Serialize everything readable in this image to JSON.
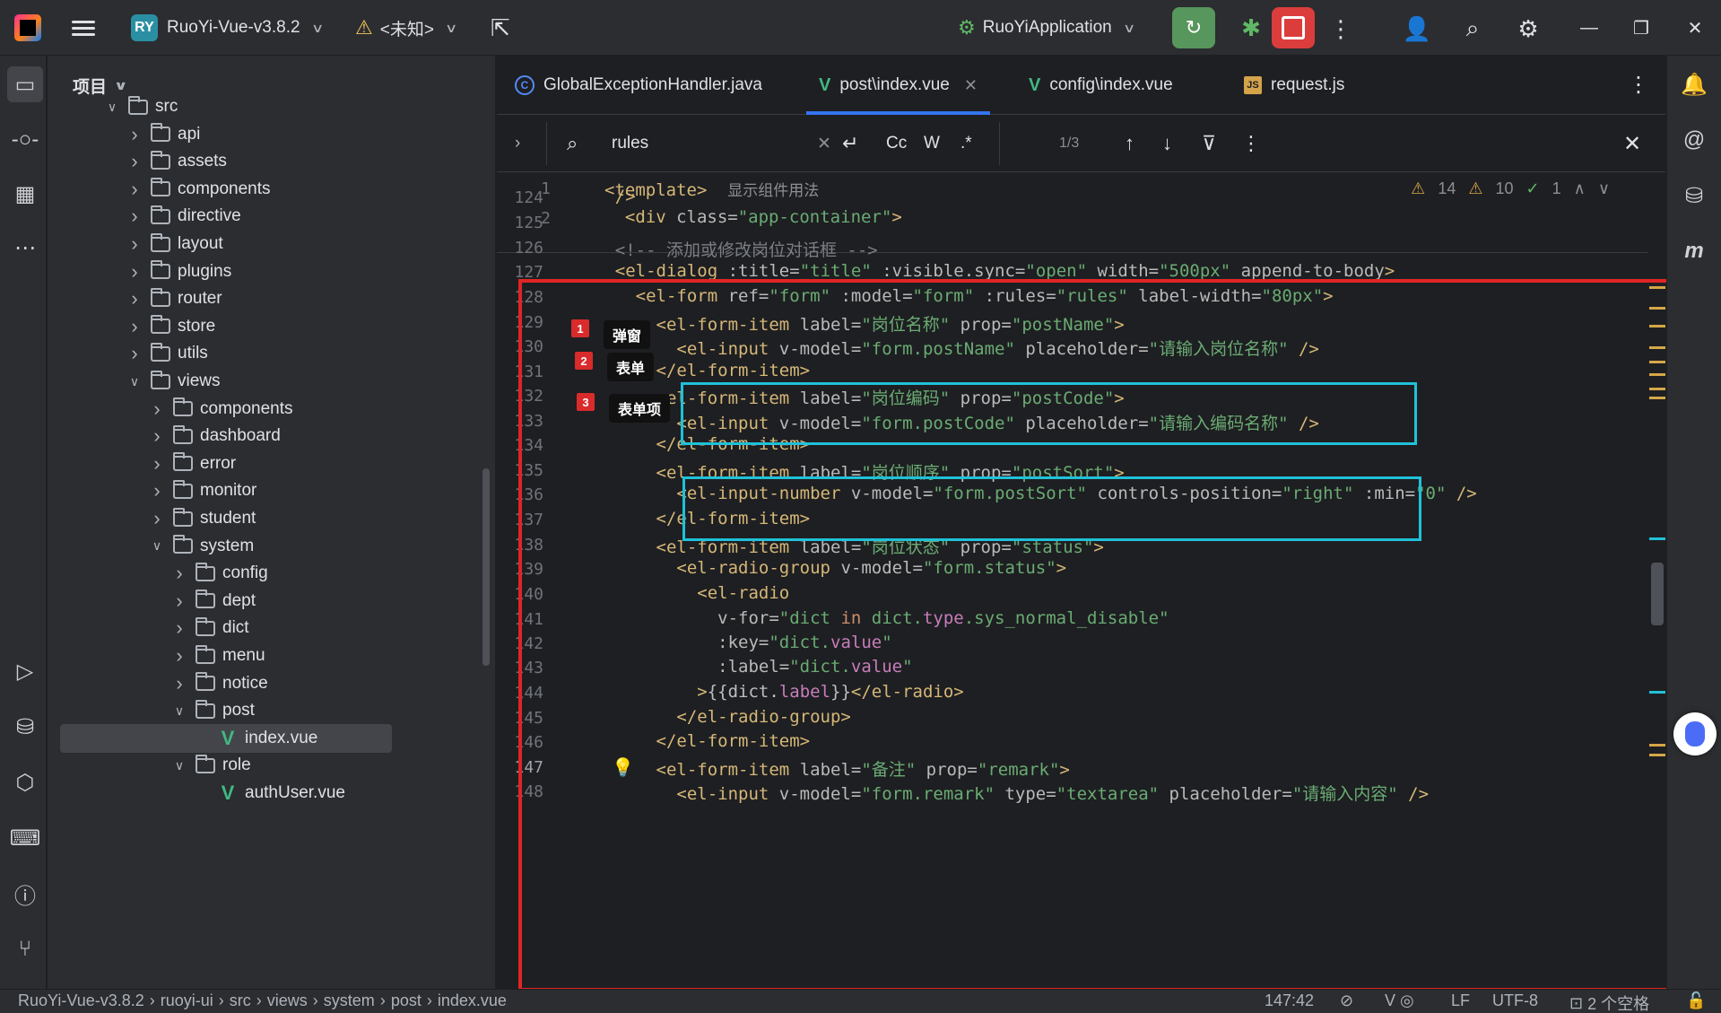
{
  "titlebar": {
    "project_badge": "RY",
    "project_name": "RuoYi-Vue-v3.8.2",
    "vcs_status": "<未知>",
    "run_config": "RuoYiApplication"
  },
  "project_panel": {
    "title": "项目",
    "tree": [
      {
        "label": "src",
        "type": "folder",
        "expanded": true
      },
      {
        "label": "api",
        "type": "folder"
      },
      {
        "label": "assets",
        "type": "folder"
      },
      {
        "label": "components",
        "type": "folder"
      },
      {
        "label": "directive",
        "type": "folder"
      },
      {
        "label": "layout",
        "type": "folder"
      },
      {
        "label": "plugins",
        "type": "folder"
      },
      {
        "label": "router",
        "type": "folder"
      },
      {
        "label": "store",
        "type": "folder"
      },
      {
        "label": "utils",
        "type": "folder"
      },
      {
        "label": "views",
        "type": "folder",
        "expanded": true
      },
      {
        "label": "components",
        "type": "folder"
      },
      {
        "label": "dashboard",
        "type": "folder"
      },
      {
        "label": "error",
        "type": "folder"
      },
      {
        "label": "monitor",
        "type": "folder"
      },
      {
        "label": "student",
        "type": "folder"
      },
      {
        "label": "system",
        "type": "folder",
        "expanded": true
      },
      {
        "label": "config",
        "type": "folder"
      },
      {
        "label": "dept",
        "type": "folder"
      },
      {
        "label": "dict",
        "type": "folder"
      },
      {
        "label": "menu",
        "type": "folder"
      },
      {
        "label": "notice",
        "type": "folder"
      },
      {
        "label": "post",
        "type": "folder",
        "expanded": true
      },
      {
        "label": "index.vue",
        "type": "vue",
        "selected": true
      },
      {
        "label": "role",
        "type": "folder",
        "expanded": true
      },
      {
        "label": "authUser.vue",
        "type": "vue"
      }
    ]
  },
  "tabs": [
    {
      "label": "GlobalExceptionHandler.java",
      "kind": "java"
    },
    {
      "label": "post\\index.vue",
      "kind": "vue",
      "active": true
    },
    {
      "label": "config\\index.vue",
      "kind": "vue"
    },
    {
      "label": "request.js",
      "kind": "js"
    }
  ],
  "find": {
    "query": "rules",
    "match_case": "Cc",
    "words": "W",
    "regex": ".*",
    "count": "1/3"
  },
  "inspections": {
    "warnings_a": "14",
    "warnings_b": "10",
    "ok": "1"
  },
  "sticky_lines": [
    {
      "num": "1",
      "text": "<template>",
      "hint": "显示组件用法"
    },
    {
      "num": "2",
      "text": "  <div class=\"app-container\">"
    }
  ],
  "code": [
    {
      "num": "124",
      "html": "<span class=\"t-tag\">    /></span>"
    },
    {
      "num": "125",
      "html": ""
    },
    {
      "num": "126",
      "html": "<span class=\"t-cmt\">    &lt;!-- 添加或修改岗位对话框 --&gt;</span>"
    },
    {
      "num": "127",
      "html": "    <span class=\"t-tag\">&lt;el-dialog</span> <span class=\"t-attr\">:title=</span><span class=\"t-str\">\"title\"</span> <span class=\"t-attr\">:visible.sync=</span><span class=\"t-str\">\"open\"</span> <span class=\"t-attr\">width=</span><span class=\"t-str\">\"500px\"</span> <span class=\"t-attr\">append-to-body</span><span class=\"t-tag\">&gt;</span>"
    },
    {
      "num": "128",
      "html": "      <span class=\"t-tag\">&lt;el-form</span> <span class=\"t-attr\">ref=</span><span class=\"t-str\">\"form\"</span> <span class=\"t-attr\">:model=</span><span class=\"t-str\">\"form\"</span> <span class=\"t-attr\">:rules=</span><span class=\"t-str\">\"rules\"</span> <span class=\"t-attr\">label-width=</span><span class=\"t-str\">\"80px\"</span><span class=\"t-tag\">&gt;</span>"
    },
    {
      "num": "129",
      "html": "        <span class=\"t-tag\">&lt;el-form-item</span> <span class=\"t-attr\">label=</span><span class=\"t-str\">\"岗位名称\"</span> <span class=\"t-attr\">prop=</span><span class=\"t-str\">\"postName\"</span><span class=\"t-tag\">&gt;</span>"
    },
    {
      "num": "130",
      "html": "          <span class=\"t-tag\">&lt;el-input</span> <span class=\"t-attr\">v-model=</span><span class=\"t-str\">\"form.postName\"</span> <span class=\"t-attr\">placeholder=</span><span class=\"t-str\">\"请输入岗位名称\"</span> <span class=\"t-tag\">/&gt;</span>"
    },
    {
      "num": "131",
      "html": "        <span class=\"t-tag\">&lt;/el-form-item&gt;</span>"
    },
    {
      "num": "132",
      "html": "        <span class=\"t-tag\">&lt;el-form-item</span> <span class=\"t-attr\">label=</span><span class=\"t-str\">\"岗位编码\"</span> <span class=\"t-attr\">prop=</span><span class=\"t-str\">\"postCode\"</span><span class=\"t-tag\">&gt;</span>"
    },
    {
      "num": "133",
      "html": "          <span class=\"t-tag\">&lt;el-input</span> <span class=\"t-attr\">v-model=</span><span class=\"t-str\">\"form.postCode\"</span> <span class=\"t-attr\">placeholder=</span><span class=\"t-str\">\"请输入编码名称\"</span> <span class=\"t-tag\">/&gt;</span>"
    },
    {
      "num": "134",
      "html": "        <span class=\"t-tag\">&lt;/el-form-item&gt;</span>"
    },
    {
      "num": "135",
      "html": "        <span class=\"t-tag\">&lt;el-form-item</span> <span class=\"t-attr\">label=</span><span class=\"t-str\">\"岗位顺序\"</span> <span class=\"t-attr\">prop=</span><span class=\"t-str\">\"postSort\"</span><span class=\"t-tag\">&gt;</span>"
    },
    {
      "num": "136",
      "html": "          <span class=\"t-tag\">&lt;el-input-number</span> <span class=\"t-attr\">v-model=</span><span class=\"t-str\">\"form.postSort\"</span> <span class=\"t-attr\">controls-position=</span><span class=\"t-str\">\"right\"</span> <span class=\"t-attr\">:min=</span><span class=\"t-str\">\"0\"</span> <span class=\"t-tag\">/&gt;</span>"
    },
    {
      "num": "137",
      "html": "        <span class=\"t-tag\">&lt;/el-form-item&gt;</span>"
    },
    {
      "num": "138",
      "html": "        <span class=\"t-tag\">&lt;el-form-item</span> <span class=\"t-attr\">label=</span><span class=\"t-str\">\"岗位状态\"</span> <span class=\"t-attr\">prop=</span><span class=\"t-str\">\"status\"</span><span class=\"t-tag\">&gt;</span>"
    },
    {
      "num": "139",
      "html": "          <span class=\"t-tag\">&lt;el-radio-group</span> <span class=\"t-attr\">v-model=</span><span class=\"t-str\">\"form.status\"</span><span class=\"t-tag\">&gt;</span>"
    },
    {
      "num": "140",
      "html": "            <span class=\"t-tag\">&lt;el-radio</span>"
    },
    {
      "num": "141",
      "html": "              <span class=\"t-attr\">v-for=</span><span class=\"t-str\">\"dict </span><span class=\"t-kw\">in</span><span class=\"t-str\"> dict.</span><span class=\"t-var\">type</span><span class=\"t-str\">.sys_normal_disable\"</span>"
    },
    {
      "num": "142",
      "html": "              <span class=\"t-attr\">:key=</span><span class=\"t-str\">\"dict.</span><span class=\"t-var\">value</span><span class=\"t-str\">\"</span>"
    },
    {
      "num": "143",
      "html": "              <span class=\"t-attr\">:label=</span><span class=\"t-str\">\"dict.</span><span class=\"t-var\">value</span><span class=\"t-str\">\"</span>"
    },
    {
      "num": "144",
      "html": "            <span class=\"t-tag\">&gt;</span>{{dict.<span class=\"t-var\">label</span>}}<span class=\"t-tag\">&lt;/el-radio&gt;</span>"
    },
    {
      "num": "145",
      "html": "          <span class=\"t-tag\">&lt;/el-radio-group&gt;</span>"
    },
    {
      "num": "146",
      "html": "        <span class=\"t-tag\">&lt;/el-form-item&gt;</span>"
    },
    {
      "num": "147",
      "html": "        <span class=\"t-tag\">&lt;el-form-item</span> <span class=\"t-attr\">label=</span><span class=\"t-str\">\"备注\"</span> <span class=\"t-attr\">prop=</span><span class=\"t-str\">\"remark\"</span><span class=\"t-tag\">&gt;</span>"
    },
    {
      "num": "148",
      "html": "          <span class=\"t-tag\">&lt;el-input</span> <span class=\"t-attr\">v-model=</span><span class=\"t-str\">\"form.remark\"</span> <span class=\"t-attr\">type=</span><span class=\"t-str\">\"textarea\"</span> <span class=\"t-attr\">placeholder=</span><span class=\"t-str\">\"请输入内容\"</span> <span class=\"t-tag\">/&gt;</span>"
    }
  ],
  "annotations": [
    {
      "num": "1",
      "label": "弹窗"
    },
    {
      "num": "2",
      "label": "表单"
    },
    {
      "num": "3",
      "label": "表单项"
    }
  ],
  "statusbar": {
    "breadcrumb": [
      "RuoYi-Vue-v3.8.2",
      "ruoyi-ui",
      "src",
      "views",
      "system",
      "post",
      "index.vue"
    ],
    "position": "147:42",
    "line_sep": "LF",
    "encoding": "UTF-8",
    "indent": "2 个空格"
  },
  "colors": {
    "accent": "#3574f0",
    "annotation_red": "#e02424",
    "annotation_cyan": "#1fc1d8",
    "run_green": "#57965c",
    "stop_red": "#db3d3d"
  }
}
